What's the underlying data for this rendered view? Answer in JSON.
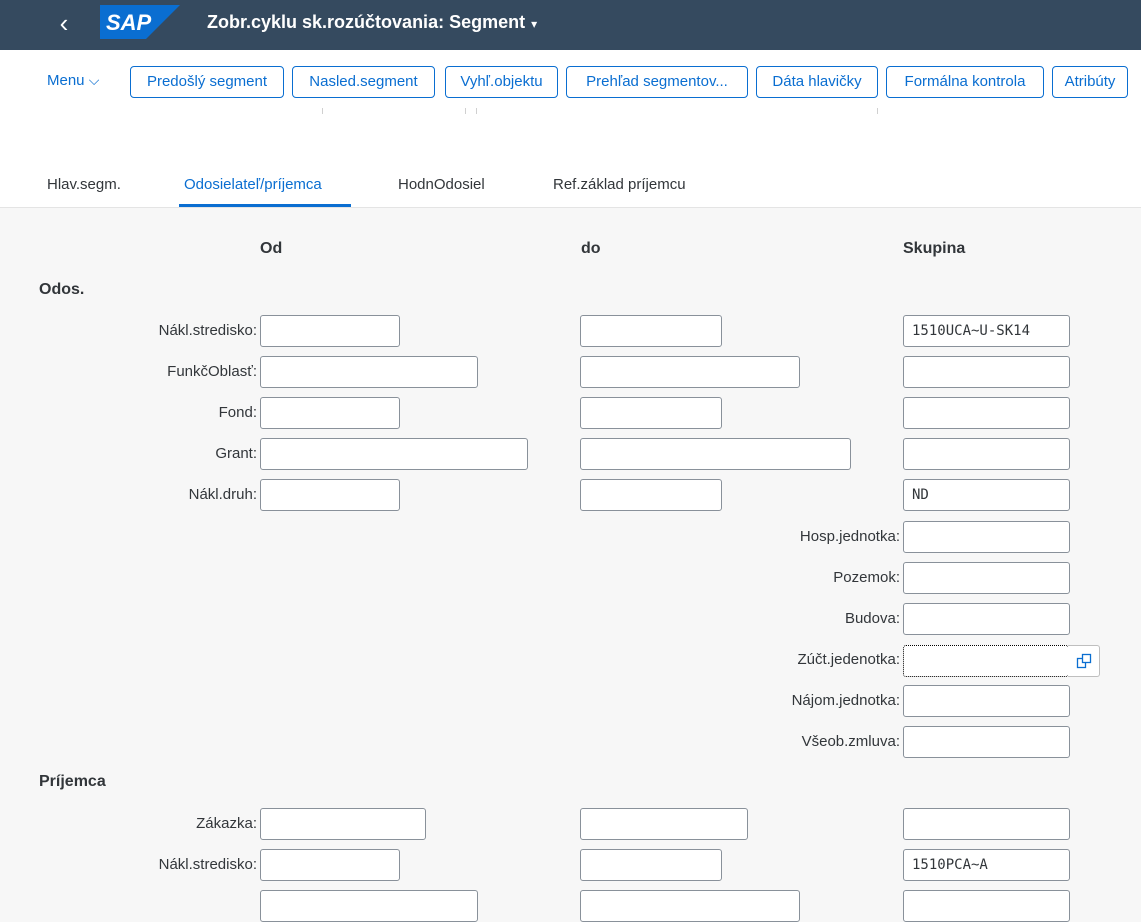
{
  "app": {
    "logo": "SAP",
    "title": "Zobr.cyklu sk.rozúčtovania: Segment",
    "title_caret": "▾",
    "back_icon": "‹"
  },
  "toolbar": {
    "menu_label": "Menu",
    "menu_caret": "⌵",
    "buttons": [
      "Predošlý segment",
      "Nasled.segment",
      "Vyhľ.objektu",
      "Prehľad segmentov...",
      "Dáta hlavičky",
      "Formálna kontrola",
      "Atribúty"
    ]
  },
  "tabs": [
    "Hlav.segm.",
    "Odosielateľ/príjemca",
    "HodnOdosiel",
    "Ref.základ príjemcu"
  ],
  "active_tab": "Odosielateľ/príjemca",
  "columns": {
    "from": "Od",
    "to": "do",
    "group": "Skupina"
  },
  "sender": {
    "title": "Odos.",
    "fields": [
      {
        "label": "Nákl.stredisko:",
        "from": "",
        "to": "",
        "group": "1510UCA~U-SK14"
      },
      {
        "label": "FunkčOblasť:",
        "from": "",
        "to": "",
        "group": ""
      },
      {
        "label": "Fond:",
        "from": "",
        "to": "",
        "group": ""
      },
      {
        "label": "Grant:",
        "from": "",
        "to": "",
        "group": ""
      },
      {
        "label": "Nákl.druh:",
        "from": "",
        "to": "",
        "group": "ND"
      }
    ],
    "group_only": [
      {
        "label": "Hosp.jednotka:",
        "group": ""
      },
      {
        "label": "Pozemok:",
        "group": ""
      },
      {
        "label": "Budova:",
        "group": ""
      },
      {
        "label": "Zúčt.jedenotka:",
        "group": ""
      },
      {
        "label": "Nájom.jednotka:",
        "group": ""
      },
      {
        "label": "Všeob.zmluva:",
        "group": ""
      }
    ]
  },
  "receiver": {
    "title": "Príjemca",
    "fields": [
      {
        "label": "Zákazka:",
        "from": "",
        "to": "",
        "group": ""
      },
      {
        "label": "Nákl.stredisko:",
        "from": "",
        "to": "",
        "group": "1510PCA~A"
      }
    ]
  },
  "icons": {
    "value_help": "value-help-icon"
  },
  "colors": {
    "shell": "#354a5f",
    "accent": "#0a6ed1",
    "logo": "#0a6ed1"
  }
}
